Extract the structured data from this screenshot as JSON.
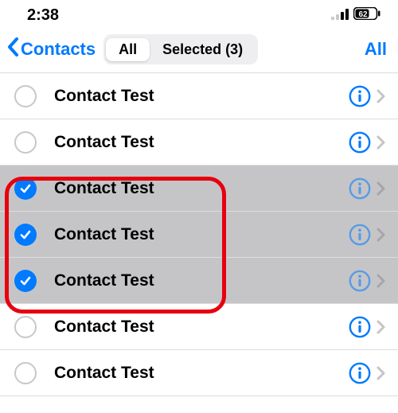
{
  "statusbar": {
    "time": "2:38",
    "battery_pct": "62"
  },
  "nav": {
    "back_label": "Contacts",
    "seg_all": "All",
    "seg_selected": "Selected (3)",
    "right_label": "All"
  },
  "contacts": [
    {
      "name": "Contact Test",
      "selected": false
    },
    {
      "name": "Contact Test",
      "selected": false
    },
    {
      "name": "Contact Test",
      "selected": true
    },
    {
      "name": "Contact Test",
      "selected": true
    },
    {
      "name": "Contact Test",
      "selected": true
    },
    {
      "name": "Contact Test",
      "selected": false
    },
    {
      "name": "Contact Test",
      "selected": false
    }
  ],
  "colors": {
    "accent": "#007aff",
    "highlight": "#e7000f"
  }
}
